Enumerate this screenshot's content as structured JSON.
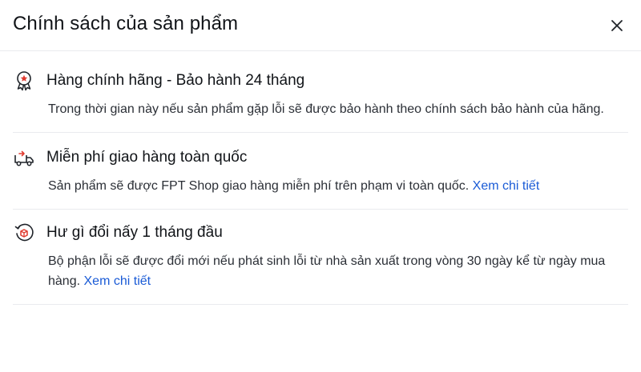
{
  "modal": {
    "title": "Chính sách của sản phẩm",
    "close_icon": "close-icon"
  },
  "policies": [
    {
      "icon": "shield-badge-icon",
      "title": "Hàng chính hãng - Bảo hành 24 tháng",
      "desc": "Trong thời gian này nếu sản phẩm gặp lỗi sẽ được bảo hành theo chính sách bảo hành của hãng.",
      "link": ""
    },
    {
      "icon": "delivery-truck-icon",
      "title": "Miễn phí giao hàng toàn quốc",
      "desc": "Sản phẩm sẽ được FPT Shop giao hàng miễn phí trên phạm vi toàn quốc.",
      "link": "Xem chi tiết"
    },
    {
      "icon": "exchange-box-icon",
      "title": "Hư gì đổi nấy 1 tháng đầu",
      "desc": "Bộ phận lỗi sẽ được đổi mới nếu phát sinh lỗi từ nhà sản xuất trong vòng 30 ngày kể từ ngày mua hàng.",
      "link": "Xem chi tiết"
    }
  ],
  "colors": {
    "link": "#1a5bd6",
    "accent_red": "#e03a2f",
    "divider": "#e9ebee"
  }
}
